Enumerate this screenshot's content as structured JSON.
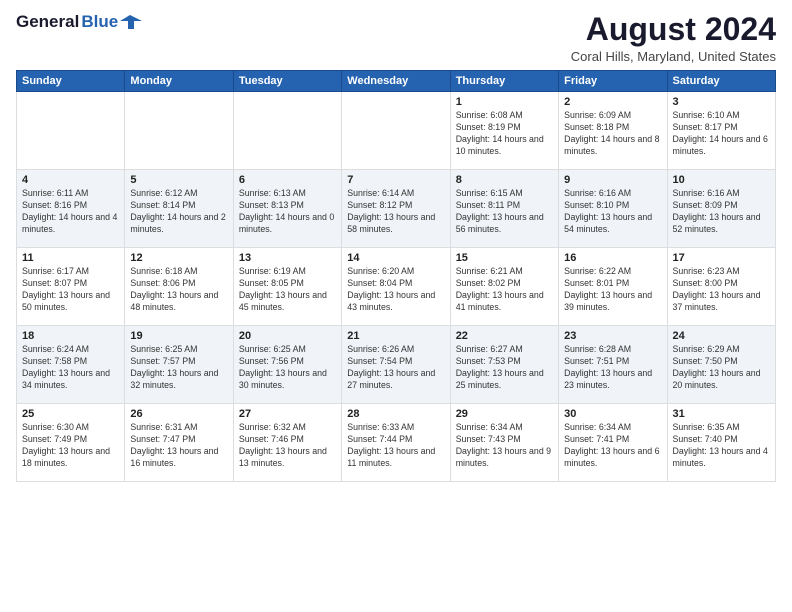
{
  "header": {
    "logo_general": "General",
    "logo_blue": "Blue",
    "main_title": "August 2024",
    "subtitle": "Coral Hills, Maryland, United States"
  },
  "columns": [
    "Sunday",
    "Monday",
    "Tuesday",
    "Wednesday",
    "Thursday",
    "Friday",
    "Saturday"
  ],
  "weeks": [
    [
      {
        "day": "",
        "content": ""
      },
      {
        "day": "",
        "content": ""
      },
      {
        "day": "",
        "content": ""
      },
      {
        "day": "",
        "content": ""
      },
      {
        "day": "1",
        "content": "Sunrise: 6:08 AM\nSunset: 8:19 PM\nDaylight: 14 hours\nand 10 minutes."
      },
      {
        "day": "2",
        "content": "Sunrise: 6:09 AM\nSunset: 8:18 PM\nDaylight: 14 hours\nand 8 minutes."
      },
      {
        "day": "3",
        "content": "Sunrise: 6:10 AM\nSunset: 8:17 PM\nDaylight: 14 hours\nand 6 minutes."
      }
    ],
    [
      {
        "day": "4",
        "content": "Sunrise: 6:11 AM\nSunset: 8:16 PM\nDaylight: 14 hours\nand 4 minutes."
      },
      {
        "day": "5",
        "content": "Sunrise: 6:12 AM\nSunset: 8:14 PM\nDaylight: 14 hours\nand 2 minutes."
      },
      {
        "day": "6",
        "content": "Sunrise: 6:13 AM\nSunset: 8:13 PM\nDaylight: 14 hours\nand 0 minutes."
      },
      {
        "day": "7",
        "content": "Sunrise: 6:14 AM\nSunset: 8:12 PM\nDaylight: 13 hours\nand 58 minutes."
      },
      {
        "day": "8",
        "content": "Sunrise: 6:15 AM\nSunset: 8:11 PM\nDaylight: 13 hours\nand 56 minutes."
      },
      {
        "day": "9",
        "content": "Sunrise: 6:16 AM\nSunset: 8:10 PM\nDaylight: 13 hours\nand 54 minutes."
      },
      {
        "day": "10",
        "content": "Sunrise: 6:16 AM\nSunset: 8:09 PM\nDaylight: 13 hours\nand 52 minutes."
      }
    ],
    [
      {
        "day": "11",
        "content": "Sunrise: 6:17 AM\nSunset: 8:07 PM\nDaylight: 13 hours\nand 50 minutes."
      },
      {
        "day": "12",
        "content": "Sunrise: 6:18 AM\nSunset: 8:06 PM\nDaylight: 13 hours\nand 48 minutes."
      },
      {
        "day": "13",
        "content": "Sunrise: 6:19 AM\nSunset: 8:05 PM\nDaylight: 13 hours\nand 45 minutes."
      },
      {
        "day": "14",
        "content": "Sunrise: 6:20 AM\nSunset: 8:04 PM\nDaylight: 13 hours\nand 43 minutes."
      },
      {
        "day": "15",
        "content": "Sunrise: 6:21 AM\nSunset: 8:02 PM\nDaylight: 13 hours\nand 41 minutes."
      },
      {
        "day": "16",
        "content": "Sunrise: 6:22 AM\nSunset: 8:01 PM\nDaylight: 13 hours\nand 39 minutes."
      },
      {
        "day": "17",
        "content": "Sunrise: 6:23 AM\nSunset: 8:00 PM\nDaylight: 13 hours\nand 37 minutes."
      }
    ],
    [
      {
        "day": "18",
        "content": "Sunrise: 6:24 AM\nSunset: 7:58 PM\nDaylight: 13 hours\nand 34 minutes."
      },
      {
        "day": "19",
        "content": "Sunrise: 6:25 AM\nSunset: 7:57 PM\nDaylight: 13 hours\nand 32 minutes."
      },
      {
        "day": "20",
        "content": "Sunrise: 6:25 AM\nSunset: 7:56 PM\nDaylight: 13 hours\nand 30 minutes."
      },
      {
        "day": "21",
        "content": "Sunrise: 6:26 AM\nSunset: 7:54 PM\nDaylight: 13 hours\nand 27 minutes."
      },
      {
        "day": "22",
        "content": "Sunrise: 6:27 AM\nSunset: 7:53 PM\nDaylight: 13 hours\nand 25 minutes."
      },
      {
        "day": "23",
        "content": "Sunrise: 6:28 AM\nSunset: 7:51 PM\nDaylight: 13 hours\nand 23 minutes."
      },
      {
        "day": "24",
        "content": "Sunrise: 6:29 AM\nSunset: 7:50 PM\nDaylight: 13 hours\nand 20 minutes."
      }
    ],
    [
      {
        "day": "25",
        "content": "Sunrise: 6:30 AM\nSunset: 7:49 PM\nDaylight: 13 hours\nand 18 minutes."
      },
      {
        "day": "26",
        "content": "Sunrise: 6:31 AM\nSunset: 7:47 PM\nDaylight: 13 hours\nand 16 minutes."
      },
      {
        "day": "27",
        "content": "Sunrise: 6:32 AM\nSunset: 7:46 PM\nDaylight: 13 hours\nand 13 minutes."
      },
      {
        "day": "28",
        "content": "Sunrise: 6:33 AM\nSunset: 7:44 PM\nDaylight: 13 hours\nand 11 minutes."
      },
      {
        "day": "29",
        "content": "Sunrise: 6:34 AM\nSunset: 7:43 PM\nDaylight: 13 hours\nand 9 minutes."
      },
      {
        "day": "30",
        "content": "Sunrise: 6:34 AM\nSunset: 7:41 PM\nDaylight: 13 hours\nand 6 minutes."
      },
      {
        "day": "31",
        "content": "Sunrise: 6:35 AM\nSunset: 7:40 PM\nDaylight: 13 hours\nand 4 minutes."
      }
    ]
  ]
}
